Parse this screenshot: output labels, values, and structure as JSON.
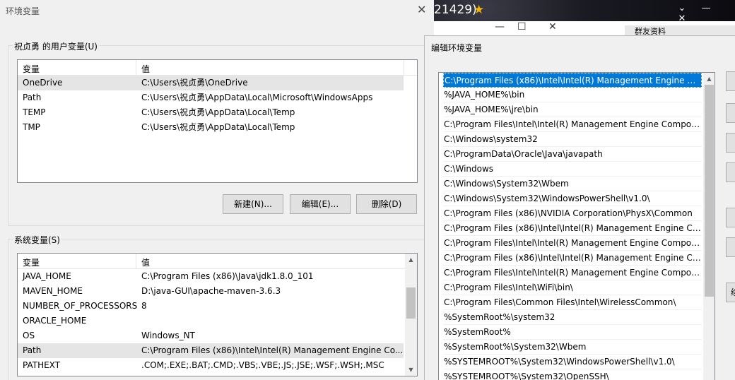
{
  "env_dialog": {
    "title": "环境变量",
    "close_glyph": "✕",
    "user_group_label": "祝贞勇 的用户变量(U)",
    "system_group_label": "系统变量(S)",
    "col_var": "变量",
    "col_val": "值",
    "user_vars": [
      {
        "name": "OneDrive",
        "value": "C:\\Users\\祝贞勇\\OneDrive"
      },
      {
        "name": "Path",
        "value": "C:\\Users\\祝贞勇\\AppData\\Local\\Microsoft\\WindowsApps"
      },
      {
        "name": "TEMP",
        "value": "C:\\Users\\祝贞勇\\AppData\\Local\\Temp"
      },
      {
        "name": "TMP",
        "value": "C:\\Users\\祝贞勇\\AppData\\Local\\Temp"
      }
    ],
    "buttons": {
      "new": "新建(N)...",
      "edit": "编辑(E)...",
      "delete": "删除(D)"
    },
    "system_vars": [
      {
        "name": "JAVA_HOME",
        "value": "C:\\Program Files (x86)\\Java\\jdk1.8.0_101"
      },
      {
        "name": "MAVEN_HOME",
        "value": "D:\\java-GUI\\apache-maven-3.6.3"
      },
      {
        "name": "NUMBER_OF_PROCESSORS",
        "value": "8"
      },
      {
        "name": "ORACLE_HOME",
        "value": ""
      },
      {
        "name": "OS",
        "value": "Windows_NT"
      },
      {
        "name": "Path",
        "value": "C:\\Program Files (x86)\\Intel\\Intel(R) Management Engine Co..."
      },
      {
        "name": "PATHEXT",
        "value": ".COM;.EXE;.BAT;.CMD;.VBS;.VBE;.JS;.JSE;.WSF;.WSH;.MSC"
      }
    ]
  },
  "background_app": {
    "title_fragment": "21429)",
    "star_glyph": "★",
    "ctrl_chevron": "⌄",
    "ctrl_min": "—",
    "ctrl_close": "✕",
    "inner_min": "—",
    "inner_max": "☐",
    "inner_close": "✕",
    "tab_text": "群友资料"
  },
  "edit_dialog": {
    "title": "编辑环境变量",
    "side_button_fragment": "续",
    "paths": [
      "C:\\Program Files (x86)\\Intel\\Intel(R) Management Engine Co...",
      "%JAVA_HOME%\\bin",
      "%JAVA_HOME%\\jre\\bin",
      "C:\\Program Files\\Intel\\Intel(R) Management Engine Compon...",
      "C:\\Windows\\system32",
      "C:\\ProgramData\\Oracle\\Java\\javapath",
      "C:\\Windows",
      "C:\\Windows\\System32\\Wbem",
      "C:\\Windows\\System32\\WindowsPowerShell\\v1.0\\",
      "C:\\Program Files (x86)\\NVIDIA Corporation\\PhysX\\Common",
      "C:\\Program Files (x86)\\Intel\\Intel(R) Management Engine Co...",
      "C:\\Program Files\\Intel\\Intel(R) Management Engine Compon...",
      "C:\\Program Files (x86)\\Intel\\Intel(R) Management Engine Co...",
      "C:\\Program Files\\Intel\\Intel(R) Management Engine Compon...",
      "C:\\Program Files\\Intel\\WiFi\\bin\\",
      "C:\\Program Files\\Common Files\\Intel\\WirelessCommon\\",
      "%SystemRoot%\\system32",
      "%SystemRoot%",
      "%SystemRoot%\\System32\\Wbem",
      "%SYSTEMROOT%\\System32\\WindowsPowerShell\\v1.0\\",
      "%SYSTEMROOT%\\System32\\OpenSSH\\"
    ]
  }
}
